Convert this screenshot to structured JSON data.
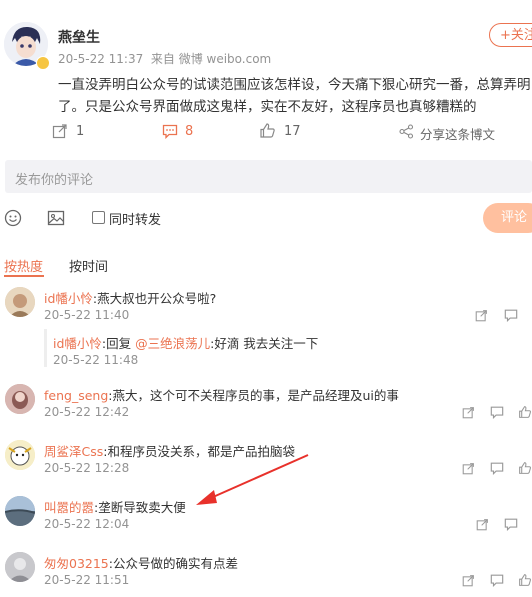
{
  "post": {
    "author": "燕垒生",
    "meta_time": "20-5-22 11:37",
    "meta_source": "来自 微博 weibo.com",
    "follow_label": "+关注",
    "content_line1": "一直没弄明白公众号的试读范围应该怎样设，今天痛下狠心研究一番，总算弄明",
    "content_line2": "了。只是公众号界面做成这鬼样，实在不友好，这程序员也真够糟糕的",
    "actions": {
      "repost_count": "1",
      "comment_count": "8",
      "like_count": "17",
      "share_label": "分享这条博文"
    }
  },
  "composer": {
    "placeholder": "发布你的评论",
    "also_repost_label": "同时转发",
    "submit_label": "评论"
  },
  "sort_tabs": {
    "hot": "按热度",
    "time": "按时间"
  },
  "comments": [
    {
      "user": "id幡小怜",
      "text": ":燕大叔也开公众号啦?",
      "time": "20-5-22 11:40"
    },
    {
      "user": "feng_seng",
      "text": ":燕大，这个可不关程序员的事，是产品经理及ui的事",
      "time": "20-5-22 12:42"
    },
    {
      "user": "周鲨泽Css",
      "text": ":和程序员没关系，都是产品拍脑袋",
      "time": "20-5-22 12:28"
    },
    {
      "user": "叫嚣的嚣",
      "text": ":垄断导致卖大便",
      "time": "20-5-22 12:04"
    },
    {
      "user": "匆匆03215",
      "text": ":公众号做的确实有点差",
      "time": "20-5-22 11:51"
    }
  ],
  "reply": {
    "user": "id幡小怜",
    "reply_word": ":回复 ",
    "target": "@三绝浪荡儿",
    "text": ":好滴 我去关注一下",
    "time": "20-5-22 11:48"
  },
  "colors": {
    "accent": "#eb7350",
    "submit_bg": "#ffc09f",
    "input_bg": "#f2f2f5",
    "arrow": "#e8312b"
  }
}
